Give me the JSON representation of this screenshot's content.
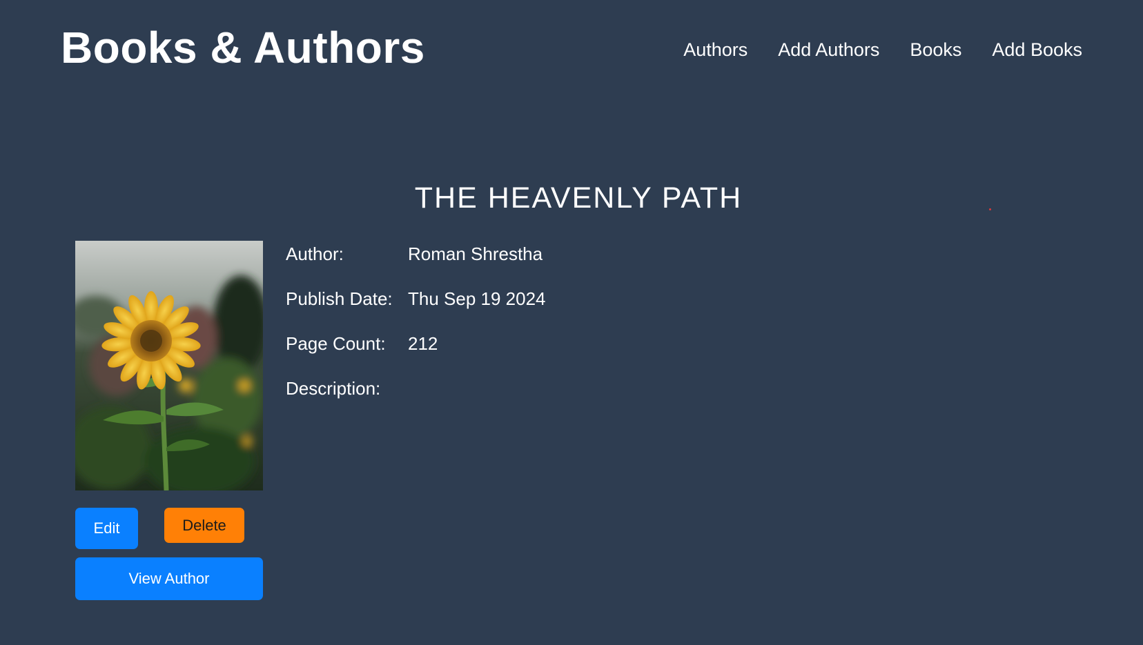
{
  "header": {
    "brand": "Books & Authors",
    "nav": [
      "Authors",
      "Add Authors",
      "Books",
      "Add Books"
    ]
  },
  "book": {
    "title": "THE HEAVENLY PATH",
    "details": [
      {
        "label": "Author:",
        "value": "Roman Shrestha"
      },
      {
        "label": "Publish Date:",
        "value": "Thu Sep 19 2024"
      },
      {
        "label": "Page Count:",
        "value": "212"
      },
      {
        "label": "Description:",
        "value": ""
      }
    ],
    "cover_subject": "sunflower-photo"
  },
  "actions": {
    "edit": "Edit",
    "delete": "Delete",
    "view_author": "View Author"
  },
  "colors": {
    "background": "#2e3d51",
    "primary_button": "#0a80ff",
    "danger_button": "#ff8006",
    "text": "#ffffff"
  }
}
